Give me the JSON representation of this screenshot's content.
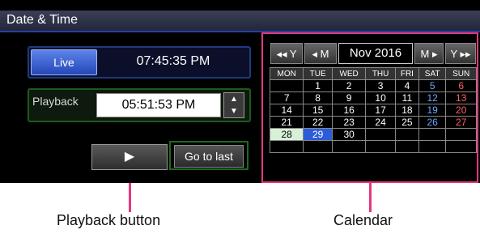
{
  "window": {
    "title": "Date & Time"
  },
  "live": {
    "button_label": "Live",
    "time": "07:45:35 PM"
  },
  "playback": {
    "label": "Playback",
    "time": "05:51:53 PM",
    "spin_up": "▲",
    "spin_down": "▼"
  },
  "buttons": {
    "play_glyph": "▶",
    "go_to_last": "Go to last"
  },
  "calendar": {
    "nav": {
      "prev_year": "◂◂ Y",
      "prev_month": "◂ M",
      "month_year": "Nov 2016",
      "next_month": "M ▸",
      "next_year": "Y ▸▸"
    },
    "weekdays": [
      "MON",
      "TUE",
      "WED",
      "THU",
      "FRI",
      "SAT",
      "SUN"
    ],
    "weeks": [
      [
        "",
        "1",
        "2",
        "3",
        "4",
        "5",
        "6"
      ],
      [
        "7",
        "8",
        "9",
        "10",
        "11",
        "12",
        "13"
      ],
      [
        "14",
        "15",
        "16",
        "17",
        "18",
        "19",
        "20"
      ],
      [
        "21",
        "22",
        "23",
        "24",
        "25",
        "26",
        "27"
      ],
      [
        "28",
        "29",
        "30",
        "",
        "",
        "",
        ""
      ],
      [
        "",
        "",
        "",
        "",
        "",
        "",
        ""
      ]
    ],
    "highlighted_green": "28",
    "highlighted_blue": "29"
  },
  "captions": {
    "playback_button": "Playback button",
    "calendar": "Calendar"
  },
  "colors": {
    "accent_pink": "#e5377f",
    "live_blue": "#2547b8",
    "frame_green": "#1c5a1c"
  }
}
